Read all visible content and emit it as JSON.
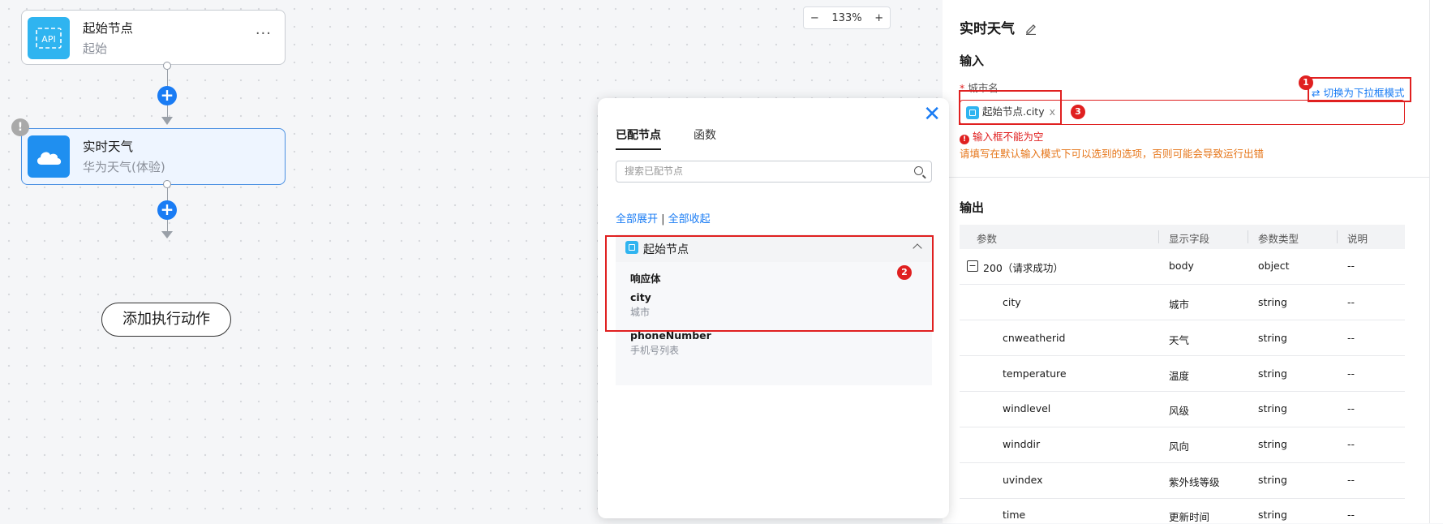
{
  "canvas": {
    "start_node": {
      "title": "起始节点",
      "subtitle": "起始",
      "icon": "api-icon",
      "more": "···"
    },
    "weather_node": {
      "title": "实时天气",
      "subtitle": "华为天气(体验)",
      "icon": "cloud-icon"
    },
    "warning_badge": "!",
    "add_action_label": "添加执行动作",
    "zoom": {
      "minus": "−",
      "level": "133%",
      "plus": "+"
    }
  },
  "popup": {
    "tabs": [
      "已配节点",
      "函数"
    ],
    "search_placeholder": "搜索已配节点",
    "expand_all": "全部展开",
    "separator": " | ",
    "collapse_all": "全部收起",
    "tree": {
      "node_label": "起始节点",
      "group_label": "响应体",
      "items": [
        {
          "name": "city",
          "desc": "城市"
        },
        {
          "name": "phoneNumber",
          "desc": "手机号列表"
        }
      ]
    },
    "close": "✕"
  },
  "panel": {
    "title": "实时天气",
    "input_section": "输入",
    "required_mark": "*",
    "field_label": "城市名",
    "switch_mode": "切换为下拉框模式",
    "chip_text": "起始节点.city",
    "chip_remove": "x",
    "error_text": "输入框不能为空",
    "hint_text": "请填写在默认输入模式下可以选到的选项，否则可能会导致运行出错",
    "output_section": "输出",
    "table": {
      "headers": [
        "参数",
        "显示字段",
        "参数类型",
        "说明"
      ],
      "group_row": {
        "param": "200（请求成功）",
        "field": "body",
        "type": "object",
        "desc": "--",
        "toggle": "−"
      },
      "rows": [
        {
          "param": "city",
          "field": "城市",
          "type": "string",
          "desc": "--"
        },
        {
          "param": "cnweatherid",
          "field": "天气",
          "type": "string",
          "desc": "--"
        },
        {
          "param": "temperature",
          "field": "温度",
          "type": "string",
          "desc": "--"
        },
        {
          "param": "windlevel",
          "field": "风级",
          "type": "string",
          "desc": "--"
        },
        {
          "param": "winddir",
          "field": "风向",
          "type": "string",
          "desc": "--"
        },
        {
          "param": "uvindex",
          "field": "紫外线等级",
          "type": "string",
          "desc": "--"
        },
        {
          "param": "time",
          "field": "更新时间",
          "type": "string",
          "desc": "--"
        }
      ]
    }
  },
  "annotations": [
    "1",
    "2",
    "3"
  ],
  "colors": {
    "accent": "#1a7cf4",
    "node_icon": "#2fb4f0",
    "annotation": "#e02020",
    "hint": "#e6761a"
  }
}
